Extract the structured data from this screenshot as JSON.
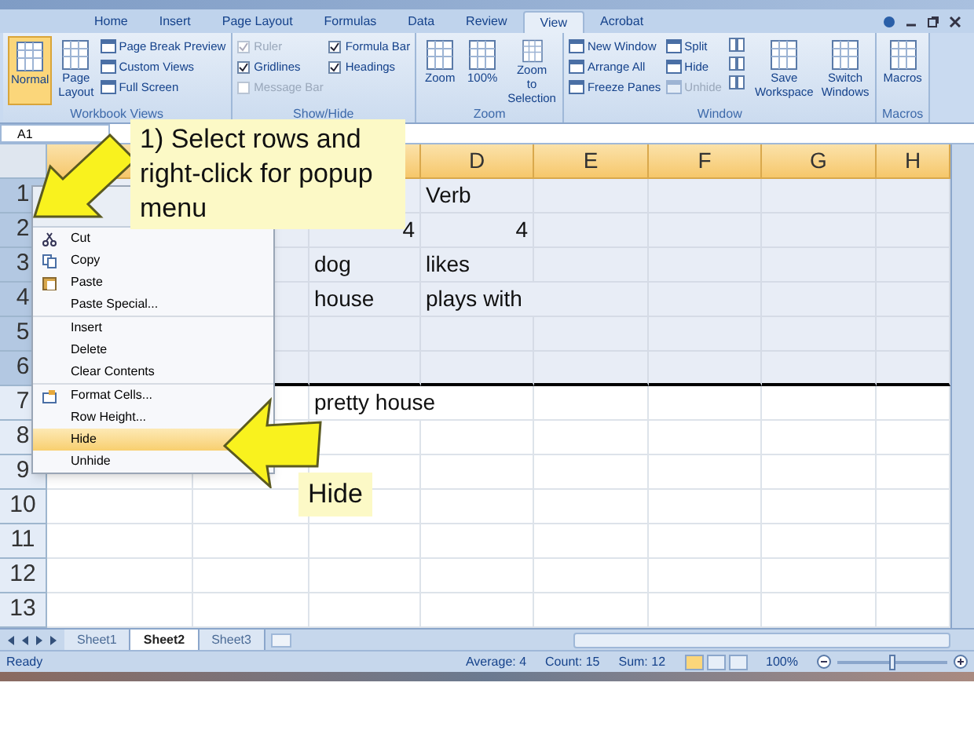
{
  "ribbon": {
    "tabs": [
      {
        "label": "Home",
        "selected": false
      },
      {
        "label": "Insert",
        "selected": false
      },
      {
        "label": "Page Layout",
        "selected": false
      },
      {
        "label": "Formulas",
        "selected": false
      },
      {
        "label": "Data",
        "selected": false
      },
      {
        "label": "Review",
        "selected": false
      },
      {
        "label": "View",
        "selected": true
      },
      {
        "label": "Acrobat",
        "selected": false
      }
    ],
    "groups": [
      {
        "label": "Workbook Views",
        "controls": [
          {
            "kind": "large",
            "label": "Normal",
            "selected": true
          },
          {
            "kind": "large",
            "label": "Page Layout",
            "selected": false
          },
          {
            "kind": "small",
            "label": "Page Break Preview",
            "disabled": false
          },
          {
            "kind": "small",
            "label": "Custom Views",
            "disabled": false
          },
          {
            "kind": "small",
            "label": "Full Screen",
            "disabled": false
          }
        ]
      },
      {
        "label": "Show/Hide",
        "controls": [
          {
            "kind": "check",
            "label": "Ruler",
            "checked": true,
            "disabled": true
          },
          {
            "kind": "check",
            "label": "Gridlines",
            "checked": true,
            "disabled": false
          },
          {
            "kind": "check",
            "label": "Message Bar",
            "checked": false,
            "disabled": true
          },
          {
            "kind": "check",
            "label": "Formula Bar",
            "checked": true,
            "disabled": false
          },
          {
            "kind": "check",
            "label": "Headings",
            "checked": true,
            "disabled": false
          }
        ]
      },
      {
        "label": "Zoom",
        "controls": [
          {
            "kind": "large",
            "label": "Zoom",
            "selected": false
          },
          {
            "kind": "large",
            "label": "100%",
            "selected": false
          },
          {
            "kind": "large",
            "label": "Zoom to Selection",
            "selected": false
          }
        ]
      },
      {
        "label": "Window",
        "controls": [
          {
            "kind": "small",
            "label": "New Window",
            "disabled": false
          },
          {
            "kind": "small",
            "label": "Arrange All",
            "disabled": false
          },
          {
            "kind": "small",
            "label": "Freeze Panes",
            "disabled": false
          },
          {
            "kind": "small",
            "label": "Split",
            "disabled": false
          },
          {
            "kind": "small",
            "label": "Hide",
            "disabled": false
          },
          {
            "kind": "small",
            "label": "Unhide",
            "disabled": true
          },
          {
            "kind": "large",
            "label": "Save Workspace",
            "selected": false
          },
          {
            "kind": "large",
            "label": "Switch Windows",
            "selected": false
          }
        ]
      },
      {
        "label": "Macros",
        "controls": [
          {
            "kind": "large",
            "label": "Macros",
            "selected": false
          }
        ]
      }
    ]
  },
  "name_box": "A1",
  "column_headers": [
    "D",
    "E",
    "F",
    "G",
    "H"
  ],
  "rows": [
    {
      "number": "1",
      "selected": true,
      "cells": {
        "D": "Verb"
      }
    },
    {
      "number": "2",
      "selected": true,
      "cells": {
        "C": "4",
        "D": "4"
      }
    },
    {
      "number": "3",
      "selected": true,
      "cells": {
        "C": "dog",
        "D": "likes"
      }
    },
    {
      "number": "4",
      "selected": true,
      "cells": {
        "C": "house",
        "D": "plays with"
      }
    },
    {
      "number": "5",
      "selected": true
    },
    {
      "number": "6",
      "selected": true
    },
    {
      "number": "7",
      "selected": false,
      "cells": {
        "C": "pretty house"
      }
    },
    {
      "number": "8",
      "selected": false
    },
    {
      "number": "9",
      "selected": false
    },
    {
      "number": "10",
      "selected": false
    },
    {
      "number": "11",
      "selected": false
    },
    {
      "number": "12",
      "selected": false
    },
    {
      "number": "13",
      "selected": false
    }
  ],
  "context_menu": {
    "groups": [
      [
        {
          "label": "Cut",
          "selected": false
        },
        {
          "label": "Copy",
          "selected": false
        },
        {
          "label": "Paste",
          "selected": false
        },
        {
          "label": "Paste Special...",
          "selected": false
        }
      ],
      [
        {
          "label": "Insert",
          "selected": false
        },
        {
          "label": "Delete",
          "selected": false
        },
        {
          "label": "Clear Contents",
          "selected": false
        }
      ],
      [
        {
          "label": "Format Cells...",
          "selected": false
        },
        {
          "label": "Row Height...",
          "selected": false
        },
        {
          "label": "Hide",
          "selected": true
        },
        {
          "label": "Unhide",
          "selected": false
        }
      ]
    ]
  },
  "callouts": [
    {
      "text": "1) Select rows and right-click for popup menu"
    },
    {
      "text": "Hide"
    }
  ],
  "sheet_tabs": [
    {
      "label": "Sheet1",
      "selected": false
    },
    {
      "label": "Sheet2",
      "selected": true
    },
    {
      "label": "Sheet3",
      "selected": false
    }
  ],
  "status_bar": {
    "status": "Ready",
    "average": "Average: 4",
    "count": "Count: 15",
    "sum": "Sum: 12",
    "zoom": "100%",
    "zoom_slider": {
      "level": 0.5
    }
  }
}
